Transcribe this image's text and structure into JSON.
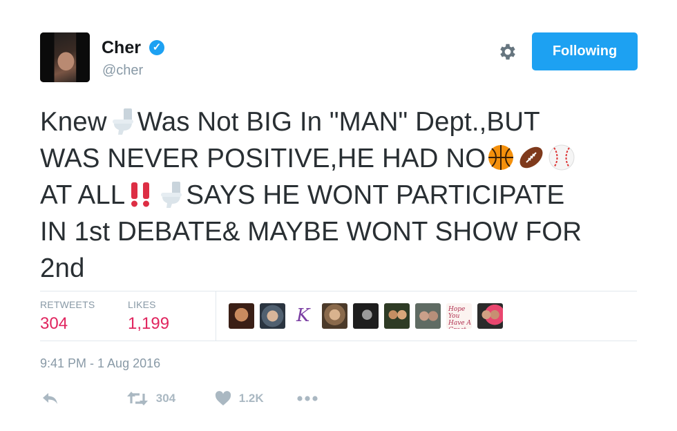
{
  "user": {
    "name": "Cher",
    "handle": "@cher",
    "verified_icon": "verified-badge-icon"
  },
  "header": {
    "follow_button": "Following",
    "settings_icon": "gear-icon"
  },
  "tweet": {
    "lines": [
      [
        "Knew",
        "{toilet}",
        "Was Not BIG In \"MAN\" Dept.,BUT"
      ],
      [
        "WAS NEVER POSITIVE,HE HAD NO",
        "{basketball}",
        "{football}",
        "{baseball}"
      ],
      [
        "AT ALL",
        "{double-exclamation}",
        "{toilet}",
        "SAYS HE WONT PARTICIPATE"
      ],
      [
        "IN 1st DEBATE& MAYBE WONT SHOW FOR"
      ],
      [
        "2nd"
      ]
    ]
  },
  "stats": {
    "retweets_label": "RETWEETS",
    "retweets_value": "304",
    "likes_label": "LIKES",
    "likes_value": "1,199",
    "liker_avatars": 9
  },
  "timestamp": "9:41 PM - 1 Aug 2016",
  "actions": {
    "reply_icon": "reply-icon",
    "retweet_icon": "retweet-icon",
    "retweet_count": "304",
    "like_icon": "heart-icon",
    "like_count": "1.2K",
    "more_icon": "more-dots-icon"
  },
  "colors": {
    "accent": "#1da1f2",
    "stat_value": "#e0245e",
    "muted": "#8899a6",
    "text": "#292f33",
    "action_icon": "#aab8c2"
  }
}
